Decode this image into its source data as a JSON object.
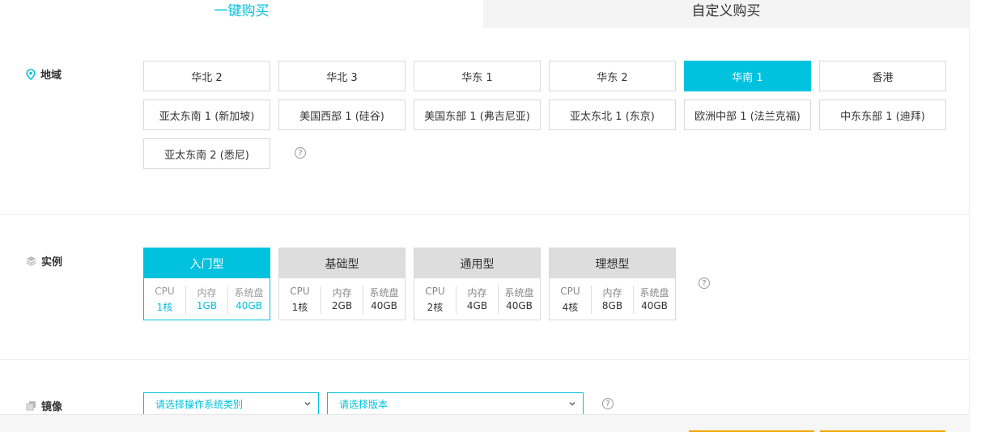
{
  "tabs": [
    {
      "label": "一键购买",
      "active": true
    },
    {
      "label": "自定义购买",
      "active": false
    }
  ],
  "region": {
    "label": "地域",
    "help": "?",
    "options": [
      {
        "label": "华北 2",
        "selected": false
      },
      {
        "label": "华北 3",
        "selected": false
      },
      {
        "label": "华东 1",
        "selected": false
      },
      {
        "label": "华东 2",
        "selected": false
      },
      {
        "label": "华南 1",
        "selected": true
      },
      {
        "label": "香港",
        "selected": false
      },
      {
        "label": "亚太东南 1 (新加坡)",
        "selected": false
      },
      {
        "label": "美国西部 1 (硅谷)",
        "selected": false
      },
      {
        "label": "美国东部 1 (弗吉尼亚)",
        "selected": false
      },
      {
        "label": "亚太东北 1 (东京)",
        "selected": false
      },
      {
        "label": "欧洲中部 1 (法兰克福)",
        "selected": false
      },
      {
        "label": "中东东部 1 (迪拜)",
        "selected": false
      },
      {
        "label": "亚太东南 2 (悉尼)",
        "selected": false
      }
    ]
  },
  "instance": {
    "label": "实例",
    "help": "?",
    "spec_headers": {
      "cpu": "CPU",
      "mem": "内存",
      "disk": "系统盘"
    },
    "types": [
      {
        "name": "入门型",
        "cpu": "1核",
        "mem": "1GB",
        "disk": "40GB",
        "selected": true
      },
      {
        "name": "基础型",
        "cpu": "1核",
        "mem": "2GB",
        "disk": "40GB",
        "selected": false
      },
      {
        "name": "通用型",
        "cpu": "2核",
        "mem": "4GB",
        "disk": "40GB",
        "selected": false
      },
      {
        "name": "理想型",
        "cpu": "4核",
        "mem": "8GB",
        "disk": "40GB",
        "selected": false
      }
    ]
  },
  "image": {
    "label": "镜像",
    "help": "?",
    "os_placeholder": "请选择操作系统类别",
    "version_placeholder": "请选择版本"
  },
  "colors": {
    "accent": "#00c1de",
    "orange": "#f0a700"
  }
}
